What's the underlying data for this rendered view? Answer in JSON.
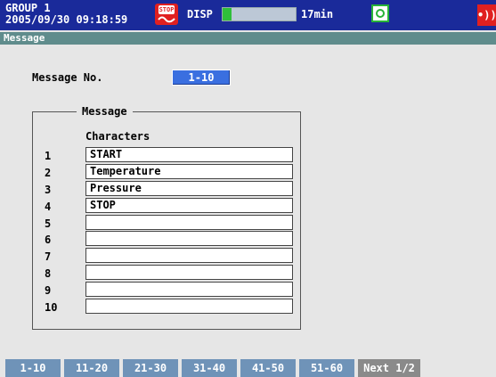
{
  "status": {
    "group_name": "GROUP 1",
    "datetime": "2005/09/30 09:18:59",
    "stop_icon_text": "STOP",
    "disp_label": "DISP",
    "memory_fill_fraction": 0.12,
    "memory_time": "17min",
    "colors": {
      "bar_bg": "#1a2a9a",
      "memory_fill": "#2fbf3a",
      "alarm": "#e02020"
    },
    "icons": [
      "stop-status-icon",
      "cf-card-icon",
      "alarm-icon"
    ]
  },
  "title": "Message",
  "message_no": {
    "label": "Message No.",
    "value": "1-10"
  },
  "group": {
    "legend": "Message",
    "column_header": "Characters",
    "rows": [
      {
        "no": "1",
        "text": "START"
      },
      {
        "no": "2",
        "text": "Temperature"
      },
      {
        "no": "3",
        "text": "Pressure"
      },
      {
        "no": "4",
        "text": "STOP"
      },
      {
        "no": "5",
        "text": ""
      },
      {
        "no": "6",
        "text": ""
      },
      {
        "no": "7",
        "text": ""
      },
      {
        "no": "8",
        "text": ""
      },
      {
        "no": "9",
        "text": ""
      },
      {
        "no": "10",
        "text": ""
      }
    ]
  },
  "softkeys": [
    "1-10",
    "11-20",
    "21-30",
    "31-40",
    "41-50",
    "51-60",
    "Next 1/2"
  ]
}
